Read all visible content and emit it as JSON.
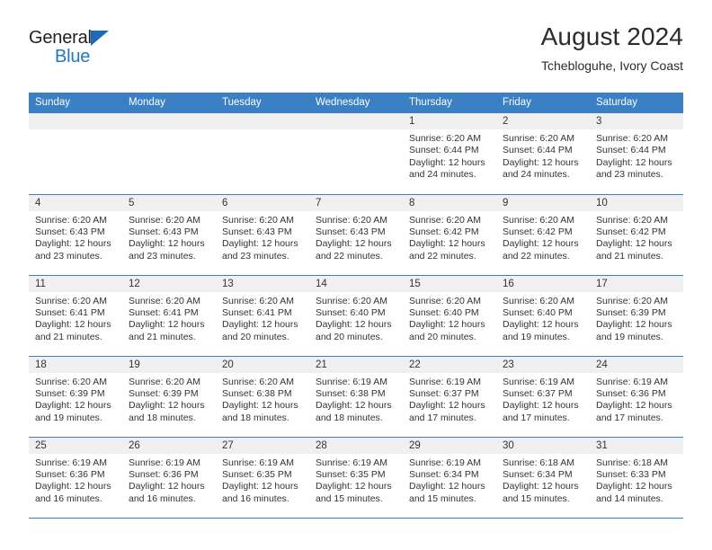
{
  "brand": {
    "name_top": "General",
    "name_bottom": "Blue",
    "accent_color": "#1f78c1"
  },
  "header": {
    "title": "August 2024",
    "subtitle": "Tchebloguhe, Ivory Coast"
  },
  "theme": {
    "header_row_bg": "#3b7fc4",
    "daynum_bg": "#f0f0f0",
    "text_color": "#333333"
  },
  "weekday_headers": [
    "Sunday",
    "Monday",
    "Tuesday",
    "Wednesday",
    "Thursday",
    "Friday",
    "Saturday"
  ],
  "labels": {
    "sunrise_prefix": "Sunrise:",
    "sunset_prefix": "Sunset:",
    "daylight_prefix": "Daylight:"
  },
  "weeks": [
    [
      {
        "day": "",
        "empty": true
      },
      {
        "day": "",
        "empty": true
      },
      {
        "day": "",
        "empty": true
      },
      {
        "day": "",
        "empty": true
      },
      {
        "day": "1",
        "sunrise": "Sunrise: 6:20 AM",
        "sunset": "Sunset: 6:44 PM",
        "daylight": "Daylight: 12 hours and 24 minutes."
      },
      {
        "day": "2",
        "sunrise": "Sunrise: 6:20 AM",
        "sunset": "Sunset: 6:44 PM",
        "daylight": "Daylight: 12 hours and 24 minutes."
      },
      {
        "day": "3",
        "sunrise": "Sunrise: 6:20 AM",
        "sunset": "Sunset: 6:44 PM",
        "daylight": "Daylight: 12 hours and 23 minutes."
      }
    ],
    [
      {
        "day": "4",
        "sunrise": "Sunrise: 6:20 AM",
        "sunset": "Sunset: 6:43 PM",
        "daylight": "Daylight: 12 hours and 23 minutes."
      },
      {
        "day": "5",
        "sunrise": "Sunrise: 6:20 AM",
        "sunset": "Sunset: 6:43 PM",
        "daylight": "Daylight: 12 hours and 23 minutes."
      },
      {
        "day": "6",
        "sunrise": "Sunrise: 6:20 AM",
        "sunset": "Sunset: 6:43 PM",
        "daylight": "Daylight: 12 hours and 23 minutes."
      },
      {
        "day": "7",
        "sunrise": "Sunrise: 6:20 AM",
        "sunset": "Sunset: 6:43 PM",
        "daylight": "Daylight: 12 hours and 22 minutes."
      },
      {
        "day": "8",
        "sunrise": "Sunrise: 6:20 AM",
        "sunset": "Sunset: 6:42 PM",
        "daylight": "Daylight: 12 hours and 22 minutes."
      },
      {
        "day": "9",
        "sunrise": "Sunrise: 6:20 AM",
        "sunset": "Sunset: 6:42 PM",
        "daylight": "Daylight: 12 hours and 22 minutes."
      },
      {
        "day": "10",
        "sunrise": "Sunrise: 6:20 AM",
        "sunset": "Sunset: 6:42 PM",
        "daylight": "Daylight: 12 hours and 21 minutes."
      }
    ],
    [
      {
        "day": "11",
        "sunrise": "Sunrise: 6:20 AM",
        "sunset": "Sunset: 6:41 PM",
        "daylight": "Daylight: 12 hours and 21 minutes."
      },
      {
        "day": "12",
        "sunrise": "Sunrise: 6:20 AM",
        "sunset": "Sunset: 6:41 PM",
        "daylight": "Daylight: 12 hours and 21 minutes."
      },
      {
        "day": "13",
        "sunrise": "Sunrise: 6:20 AM",
        "sunset": "Sunset: 6:41 PM",
        "daylight": "Daylight: 12 hours and 20 minutes."
      },
      {
        "day": "14",
        "sunrise": "Sunrise: 6:20 AM",
        "sunset": "Sunset: 6:40 PM",
        "daylight": "Daylight: 12 hours and 20 minutes."
      },
      {
        "day": "15",
        "sunrise": "Sunrise: 6:20 AM",
        "sunset": "Sunset: 6:40 PM",
        "daylight": "Daylight: 12 hours and 20 minutes."
      },
      {
        "day": "16",
        "sunrise": "Sunrise: 6:20 AM",
        "sunset": "Sunset: 6:40 PM",
        "daylight": "Daylight: 12 hours and 19 minutes."
      },
      {
        "day": "17",
        "sunrise": "Sunrise: 6:20 AM",
        "sunset": "Sunset: 6:39 PM",
        "daylight": "Daylight: 12 hours and 19 minutes."
      }
    ],
    [
      {
        "day": "18",
        "sunrise": "Sunrise: 6:20 AM",
        "sunset": "Sunset: 6:39 PM",
        "daylight": "Daylight: 12 hours and 19 minutes."
      },
      {
        "day": "19",
        "sunrise": "Sunrise: 6:20 AM",
        "sunset": "Sunset: 6:39 PM",
        "daylight": "Daylight: 12 hours and 18 minutes."
      },
      {
        "day": "20",
        "sunrise": "Sunrise: 6:20 AM",
        "sunset": "Sunset: 6:38 PM",
        "daylight": "Daylight: 12 hours and 18 minutes."
      },
      {
        "day": "21",
        "sunrise": "Sunrise: 6:19 AM",
        "sunset": "Sunset: 6:38 PM",
        "daylight": "Daylight: 12 hours and 18 minutes."
      },
      {
        "day": "22",
        "sunrise": "Sunrise: 6:19 AM",
        "sunset": "Sunset: 6:37 PM",
        "daylight": "Daylight: 12 hours and 17 minutes."
      },
      {
        "day": "23",
        "sunrise": "Sunrise: 6:19 AM",
        "sunset": "Sunset: 6:37 PM",
        "daylight": "Daylight: 12 hours and 17 minutes."
      },
      {
        "day": "24",
        "sunrise": "Sunrise: 6:19 AM",
        "sunset": "Sunset: 6:36 PM",
        "daylight": "Daylight: 12 hours and 17 minutes."
      }
    ],
    [
      {
        "day": "25",
        "sunrise": "Sunrise: 6:19 AM",
        "sunset": "Sunset: 6:36 PM",
        "daylight": "Daylight: 12 hours and 16 minutes."
      },
      {
        "day": "26",
        "sunrise": "Sunrise: 6:19 AM",
        "sunset": "Sunset: 6:36 PM",
        "daylight": "Daylight: 12 hours and 16 minutes."
      },
      {
        "day": "27",
        "sunrise": "Sunrise: 6:19 AM",
        "sunset": "Sunset: 6:35 PM",
        "daylight": "Daylight: 12 hours and 16 minutes."
      },
      {
        "day": "28",
        "sunrise": "Sunrise: 6:19 AM",
        "sunset": "Sunset: 6:35 PM",
        "daylight": "Daylight: 12 hours and 15 minutes."
      },
      {
        "day": "29",
        "sunrise": "Sunrise: 6:19 AM",
        "sunset": "Sunset: 6:34 PM",
        "daylight": "Daylight: 12 hours and 15 minutes."
      },
      {
        "day": "30",
        "sunrise": "Sunrise: 6:18 AM",
        "sunset": "Sunset: 6:34 PM",
        "daylight": "Daylight: 12 hours and 15 minutes."
      },
      {
        "day": "31",
        "sunrise": "Sunrise: 6:18 AM",
        "sunset": "Sunset: 6:33 PM",
        "daylight": "Daylight: 12 hours and 14 minutes."
      }
    ]
  ]
}
